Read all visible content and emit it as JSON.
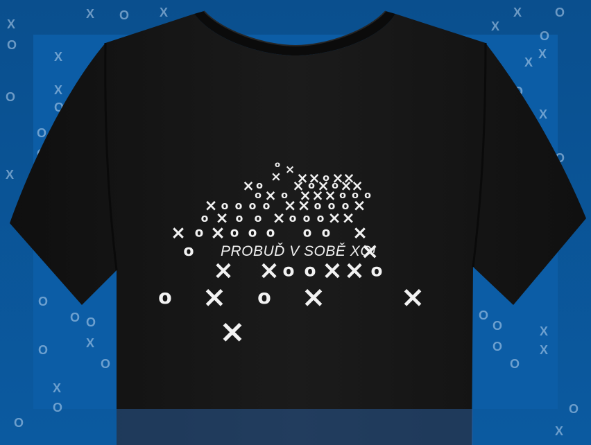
{
  "colors": {
    "background": "#0b5aa0",
    "shirt": "#161616",
    "print": "#f2f2f2"
  },
  "product": {
    "type": "t-shirt",
    "color_name": "black",
    "slogan": "PROBUĎ V SOBĚ XO!"
  }
}
